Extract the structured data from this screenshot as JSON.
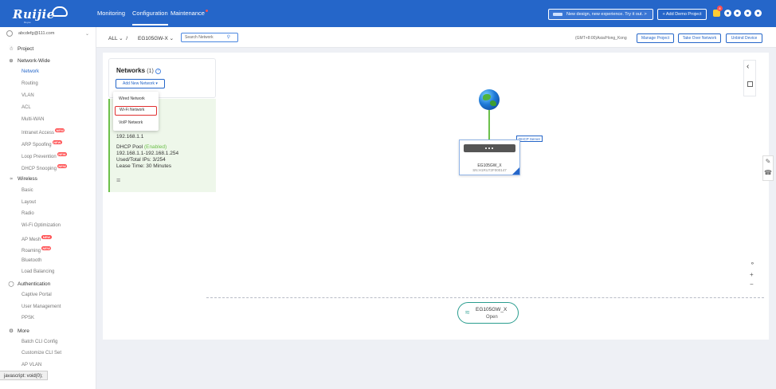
{
  "header": {
    "brand": "Ruijie",
    "brand_sub": "Reyee",
    "nav": [
      {
        "label": "Monitoring"
      },
      {
        "label": "Configuration"
      },
      {
        "label": "Maintenance"
      }
    ],
    "promo": "New design, new experience. Try it out. >",
    "demo_button": "+ Add Demo Project",
    "notification_count": "8"
  },
  "sidebar": {
    "account": "abcdefg@111.com",
    "project": "Project",
    "sections": {
      "network_wide": "Network-Wide",
      "wireless": "Wireless",
      "authentication": "Authentication",
      "more": "More"
    },
    "network_items": [
      {
        "label": "Network"
      },
      {
        "label": "Routing"
      },
      {
        "label": "VLAN"
      },
      {
        "label": "ACL"
      },
      {
        "label": "Multi-WAN"
      },
      {
        "label": "Intranet Access"
      },
      {
        "label": "ARP Spoofing"
      },
      {
        "label": "Loop Prevention"
      },
      {
        "label": "DHCP Snooping"
      }
    ],
    "wireless_items": [
      {
        "label": "Basic"
      },
      {
        "label": "Layout"
      },
      {
        "label": "Radio"
      },
      {
        "label": "Wi-Fi Optimization"
      },
      {
        "label": "AP Mesh"
      },
      {
        "label": "Roaming"
      },
      {
        "label": "Bluetooth"
      },
      {
        "label": "Load Balancing"
      }
    ],
    "auth_items": [
      {
        "label": "Captive Portal"
      },
      {
        "label": "User Management"
      },
      {
        "label": "PPSK"
      }
    ],
    "more_items": [
      {
        "label": "Batch CLI Config"
      },
      {
        "label": "Customize CLI Set"
      },
      {
        "label": "AP VLAN"
      }
    ],
    "new_badge": "NEW"
  },
  "statusbar": "javascript: void(0);",
  "subbar": {
    "scope": "ALL",
    "device": "EG105GW-X",
    "search_placeholder": "Search Network",
    "timezone": "(GMT+8:00)Asia/Hong_Kong",
    "manage_project": "Manage Project",
    "take_over": "Take Over Network",
    "unbind": "Unbind Device"
  },
  "networks": {
    "title": "Networks",
    "count": "(1)",
    "add_button": "Add New Network",
    "dropdown": [
      {
        "label": "Wired Network"
      },
      {
        "label": "Wi-Fi Network"
      },
      {
        "label": "VoIP Network"
      }
    ],
    "card": {
      "ip": "192.168.1.1",
      "dhcp_label": "DHCP Pool",
      "dhcp_status": "(Enabled)",
      "range": "192.168.1.1-192.168.1.254",
      "used": "Used/Total IPs: 3/254",
      "lease": "Lease Time: 30 Minutes"
    }
  },
  "topology": {
    "dhcp_tag": "DHCP Server",
    "device_name": "EG105GW_X",
    "device_sn": "SN:H1RU72F000147",
    "ssid_name": "EG105GW_X",
    "ssid_security": "Open"
  },
  "colors": {
    "primary": "#2566c9",
    "green": "#6cc04a",
    "badge": "#ff4d4f"
  }
}
